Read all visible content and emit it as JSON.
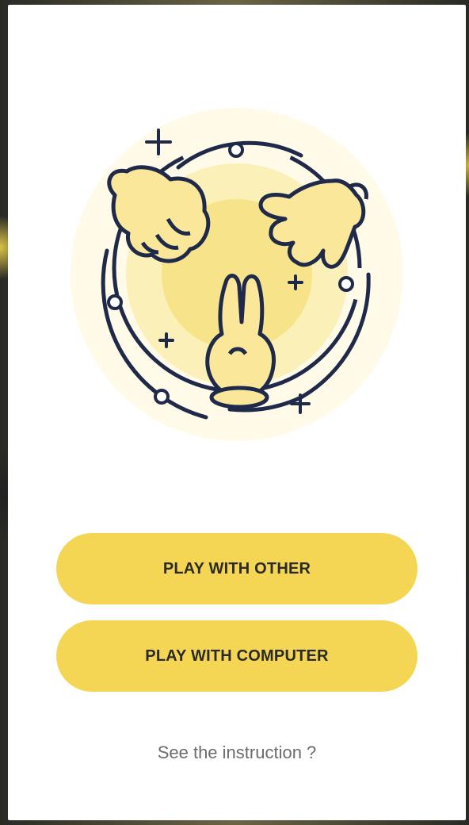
{
  "app": {
    "accent_color": "#f5d654",
    "illustration": "rock-paper-scissors-hands-icon"
  },
  "actions": {
    "play_with_other_label": "PLAY WITH OTHER",
    "play_with_computer_label": "PLAY WITH COMPUTER",
    "instruction_link": "See the instruction ?"
  }
}
